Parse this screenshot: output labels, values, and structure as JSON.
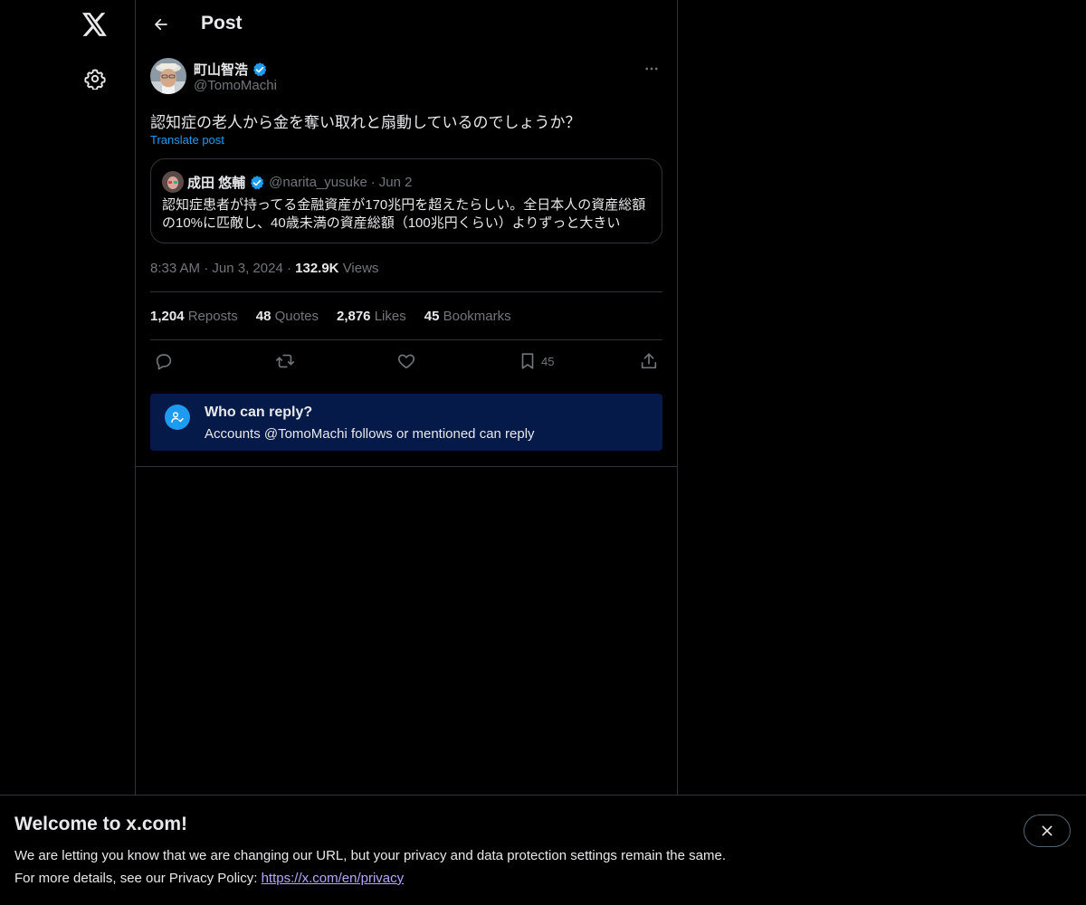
{
  "header": {
    "title": "Post"
  },
  "post": {
    "author_name": "町山智浩",
    "author_handle": "@TomoMachi",
    "text": "認知症の老人から金を奪い取れと扇動しているのでしょうか？",
    "translate_label": "Translate post",
    "time": "8:33 AM",
    "date": "Jun 3, 2024",
    "views_count": "132.9K",
    "views_label": "Views"
  },
  "quote": {
    "author_name": "成田 悠輔",
    "author_handle": "@narita_yusuke",
    "date": "Jun 2",
    "text": "認知症患者が持ってる金融資産が170兆円を超えたらしい。全日本人の資産総額の10%に匹敵し、40歳未満の資産総額（100兆円くらい）よりずっと大きい"
  },
  "stats": {
    "reposts_count": "1,204",
    "reposts_label": "Reposts",
    "quotes_count": "48",
    "quotes_label": "Quotes",
    "likes_count": "2,876",
    "likes_label": "Likes",
    "bookmarks_count": "45",
    "bookmarks_label": "Bookmarks"
  },
  "actions": {
    "bookmark_count": "45"
  },
  "reply_restriction": {
    "title": "Who can reply?",
    "subtitle": "Accounts @TomoMachi follows or mentioned can reply"
  },
  "banner": {
    "title": "Welcome to x.com!",
    "line1": "We are letting you know that we are changing our URL, but your privacy and data protection settings remain the same.",
    "line2_prefix": "For more details, see our Privacy Policy: ",
    "link_text": "https://x.com/en/privacy"
  },
  "icons": {
    "logo": "x-logo-icon",
    "settings": "gear-icon",
    "back": "arrow-left-icon",
    "more": "more-horizontal-icon",
    "verified": "verified-badge-icon",
    "reply": "reply-icon",
    "repost": "repost-icon",
    "like": "heart-icon",
    "bookmark": "bookmark-icon",
    "share": "share-icon",
    "who_can_reply": "person-check-icon",
    "close": "close-icon"
  },
  "colors": {
    "accent": "#1d9bf0",
    "background": "#000000",
    "border": "#2f3336",
    "muted_text": "#71767b",
    "reply_box_bg": "#061a4a",
    "link_purple": "#b4a9ff"
  }
}
